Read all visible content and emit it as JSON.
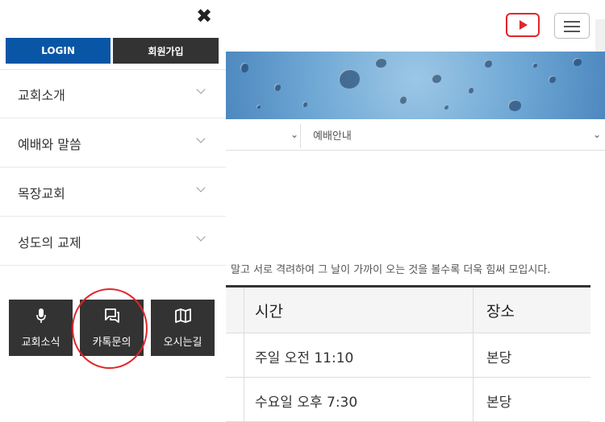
{
  "drawer": {
    "close_label": "✖",
    "login_label": "LOGIN",
    "join_label": "회원가입",
    "menu": [
      {
        "label": "교회소개"
      },
      {
        "label": "예배와 말씀"
      },
      {
        "label": "목장교회"
      },
      {
        "label": "성도의 교제"
      }
    ],
    "quick": [
      {
        "label": "교회소식",
        "icon": "microphone-icon"
      },
      {
        "label": "카톡문의",
        "icon": "chat-icon"
      },
      {
        "label": "오시는길",
        "icon": "map-icon"
      }
    ]
  },
  "header": {
    "youtube_icon": "youtube-play-icon",
    "menu_icon": "hamburger-icon"
  },
  "subnav": {
    "current": "예배안내"
  },
  "verse": "말고 서로 격려하여 그 날이 가까이 오는 것을 볼수록 더욱 힘써 모입시다.",
  "table": {
    "headers": [
      "시간",
      "장소"
    ],
    "rows": [
      [
        "주일 오전 11:10",
        "본당"
      ],
      [
        "수요일 오후 7:30",
        "본당"
      ]
    ]
  },
  "colors": {
    "accent_red": "#e0262b",
    "login_blue": "#0a56a6",
    "dark": "#333333"
  }
}
